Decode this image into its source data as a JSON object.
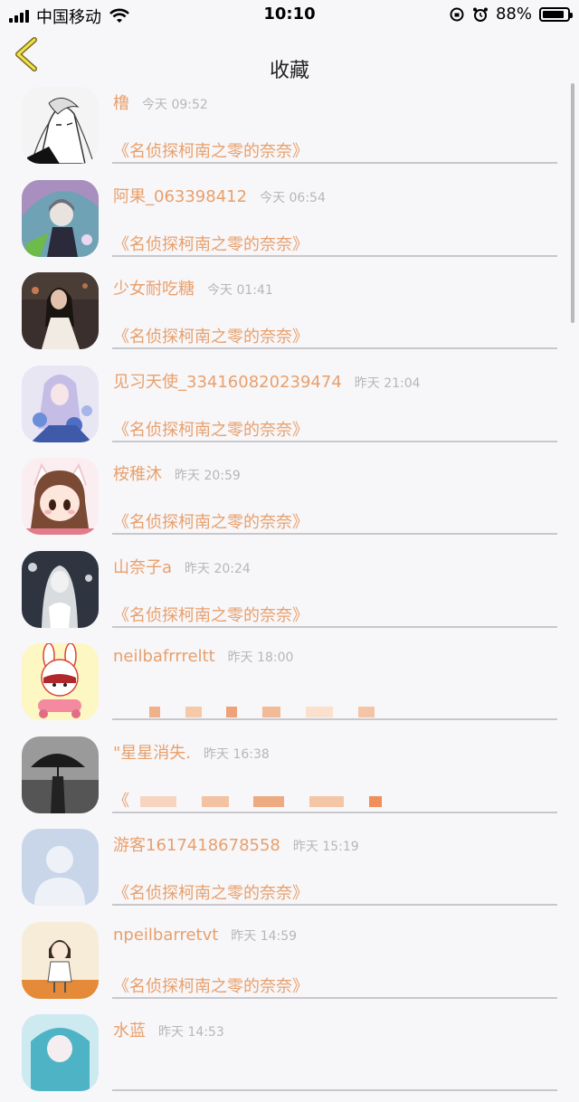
{
  "status_bar": {
    "carrier": "中国移动",
    "time": "10:10",
    "battery": "88%",
    "battery_level": 0.88
  },
  "nav": {
    "title": "收藏"
  },
  "items": [
    {
      "name": "橹",
      "time": "今天 09:52",
      "book": "《名侦探柯南之零的奈奈》",
      "avatar": "sketch-girl"
    },
    {
      "name": "阿果_063398412",
      "time": "今天 06:54",
      "book": "《名侦探柯南之零的奈奈》",
      "avatar": "umbrella-girl"
    },
    {
      "name": "少女耐吃糖",
      "time": "今天 01:41",
      "book": "《名侦探柯南之零的奈奈》",
      "avatar": "photo-girl"
    },
    {
      "name": "见习天使_334160820239474",
      "time": "昨天 21:04",
      "book": "《名侦探柯南之零的奈奈》",
      "avatar": "blue-flower-girl"
    },
    {
      "name": "桉稚沐",
      "time": "昨天 20:59",
      "book": "《名侦探柯南之零的奈奈》",
      "avatar": "chibi-girl"
    },
    {
      "name": "山奈子a",
      "time": "昨天 20:24",
      "book": "《名侦探柯南之零的奈奈》",
      "avatar": "grey-girl"
    },
    {
      "name": "neilbafrrreltt",
      "time": "昨天 18:00",
      "book": "",
      "avatar": "bunny-cartoon"
    },
    {
      "name": "\"星星消失.",
      "time": "昨天 16:38",
      "book": "《",
      "avatar": "umbrella-silhouette"
    },
    {
      "name": "游客1617418678558",
      "time": "昨天 15:19",
      "book": "《名侦探柯南之零的奈奈》",
      "avatar": "default-avatar"
    },
    {
      "name": "npeilbarretvt",
      "time": "昨天 14:59",
      "book": "《名侦探柯南之零的奈奈》",
      "avatar": "doll-girl"
    },
    {
      "name": "水蓝",
      "time": "昨天 14:53",
      "book": "",
      "avatar": "cyan-girl"
    }
  ]
}
